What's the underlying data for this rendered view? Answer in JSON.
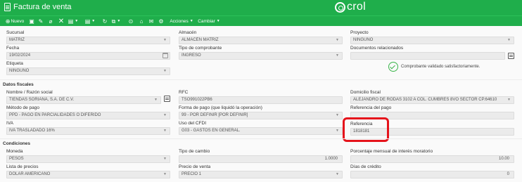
{
  "window": {
    "title": "Factura de venta",
    "logo_text": "crol"
  },
  "toolbar": {
    "new_label": "Nuevo",
    "actions_label": "Acciones",
    "change_label": "Cambiar"
  },
  "general": {
    "sucursal": {
      "label": "Sucursal",
      "value": "MATRIZ"
    },
    "almacen": {
      "label": "Almacén",
      "value": "ALMACÉN MATRIZ"
    },
    "proyecto": {
      "label": "Proyecto",
      "value": "NINGUNO"
    },
    "fecha": {
      "label": "Fecha",
      "value": "19/02/2024"
    },
    "tipo_comprobante": {
      "label": "Tipo de comprobante",
      "value": "INGRESO"
    },
    "documentos": {
      "label": "Documentos relacionados",
      "value": ""
    },
    "etiqueta": {
      "label": "Etiqueta",
      "value": "NINGUNO"
    },
    "validation_message": "Comprobante validado satisfactoriamente."
  },
  "fiscal": {
    "section_title": "Datos fiscales",
    "nombre": {
      "label": "Nombre / Razón social",
      "value": "TIENDAS SORIANA, S.A. DE C.V."
    },
    "rfc": {
      "label": "RFC",
      "value": "TSO991022PB6"
    },
    "domicilio": {
      "label": "Domicilio fiscal",
      "value": "ALEJANDRO DE RODAS 3102 A COL. CUMBRES 8VO SECTOR CP.64610"
    },
    "metodo_pago": {
      "label": "Método de pago",
      "value": "PPD - PAGO EN PARCIALIDADES O DIFERIDO"
    },
    "forma_pago": {
      "label": "Forma de pago (que liquidó la operación)",
      "value": "99 - POR DEFINIR [POR DEFINIR]"
    },
    "referencia_pago": {
      "label": "Referencia del pago",
      "value": ""
    },
    "iva": {
      "label": "IVA",
      "value": "IVA TRASLADADO 16%"
    },
    "uso_cfdi": {
      "label": "Uso del CFDI",
      "value": "G03 - GASTOS EN GENERAL."
    },
    "referencia": {
      "label": "Referencia",
      "value": "1818181"
    }
  },
  "conditions": {
    "section_title": "Condiciones",
    "moneda": {
      "label": "Moneda",
      "value": "PESOS"
    },
    "tipo_cambio": {
      "label": "Tipo de cambio",
      "value": "1.0000"
    },
    "interes": {
      "label": "Porcentaje mensual de interés moratorio",
      "value": "10.00"
    },
    "lista_precios": {
      "label": "Lista de precios",
      "value": "DOLAR AMERICANO"
    },
    "precio_venta": {
      "label": "Precio de venta",
      "value": "PRECIO 1"
    },
    "dias_credito": {
      "label": "Días de crédito",
      "value": "0"
    }
  },
  "colors": {
    "brand_green": "#1fae4b",
    "highlight_red": "#e5131b",
    "success_green": "#3ab54a"
  }
}
